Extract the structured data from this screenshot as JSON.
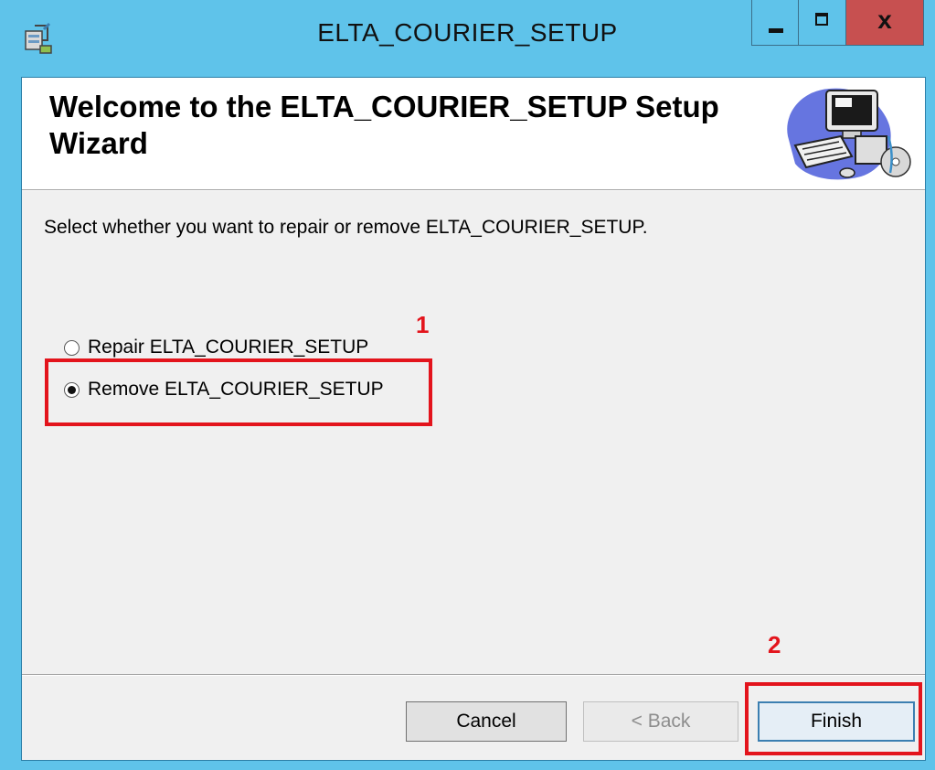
{
  "window": {
    "title": "ELTA_COURIER_SETUP",
    "controls": {
      "minimize_icon": "minimize-icon",
      "maximize_icon": "maximize-icon",
      "close_label": "x"
    },
    "accent_color": "#5fc3ea",
    "close_color": "#c75050"
  },
  "banner": {
    "title": "Welcome to the ELTA_COURIER_SETUP Setup Wizard",
    "graphic_icon": "computer-setup-graphic"
  },
  "body": {
    "instruction": "Select whether you want to repair or remove ELTA_COURIER_SETUP.",
    "options": [
      {
        "label": "Repair ELTA_COURIER_SETUP",
        "selected": false
      },
      {
        "label": "Remove ELTA_COURIER_SETUP",
        "selected": true
      }
    ]
  },
  "annotations": {
    "step1": "1",
    "step2": "2",
    "color": "#e3141c"
  },
  "buttons": {
    "cancel": "Cancel",
    "back": "< Back",
    "finish": "Finish"
  }
}
